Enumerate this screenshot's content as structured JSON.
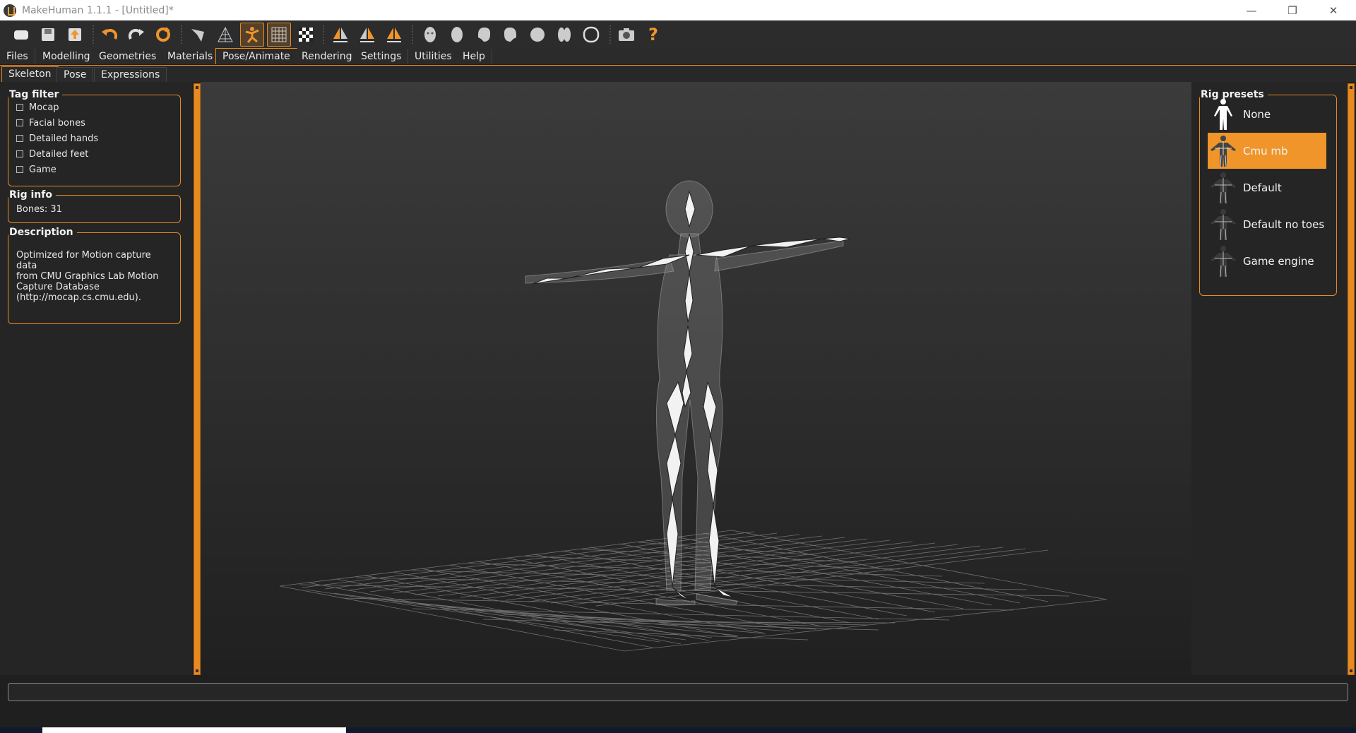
{
  "window": {
    "title": "MakeHuman 1.1.1 - [Untitled]*",
    "controls": {
      "minimize": "—",
      "maximize": "❐",
      "close": "✕"
    }
  },
  "toolbar": {
    "icons": [
      "new-icon",
      "save-icon",
      "export-icon",
      "undo-icon",
      "redo-icon",
      "reset-icon",
      "smooth-icon",
      "wireframe-icon",
      "pose-icon",
      "grid-icon",
      "checker-icon",
      "symmetry-right-icon",
      "symmetry-left-icon",
      "symmetry-both-icon",
      "front-view-icon",
      "back-view-icon",
      "left-view-icon",
      "right-view-icon",
      "top-view-icon",
      "bottom-view-icon",
      "reset-camera-icon",
      "screenshot-icon",
      "help-icon"
    ],
    "help_label": "?"
  },
  "tabs": {
    "main": [
      "Files",
      "Modelling",
      "Geometries",
      "Materials",
      "Pose/Animate",
      "Rendering",
      "Settings",
      "Utilities",
      "Help"
    ],
    "main_active": "Pose/Animate",
    "sub": [
      "Skeleton",
      "Pose",
      "Expressions"
    ],
    "sub_active": "Skeleton"
  },
  "left": {
    "tag_filter": {
      "title": "Tag filter",
      "items": [
        {
          "label": "Mocap",
          "checked": false
        },
        {
          "label": "Facial bones",
          "checked": false
        },
        {
          "label": "Detailed hands",
          "checked": false
        },
        {
          "label": "Detailed feet",
          "checked": false
        },
        {
          "label": "Game",
          "checked": false
        }
      ]
    },
    "rig_info": {
      "title": "Rig info",
      "bones": "Bones: 31"
    },
    "description": {
      "title": "Description",
      "lines": [
        "Optimized for Motion capture data",
        "from CMU Graphics Lab Motion",
        "Capture Database",
        "(http://mocap.cs.cmu.edu)."
      ]
    }
  },
  "right": {
    "rig_presets": {
      "title": "Rig presets",
      "items": [
        "None",
        "Cmu mb",
        "Default",
        "Default no toes",
        "Game engine"
      ],
      "selected": "Cmu mb"
    }
  },
  "colors": {
    "accent": "#e88a20",
    "panel": "#252525",
    "selected": "#f0952a"
  }
}
